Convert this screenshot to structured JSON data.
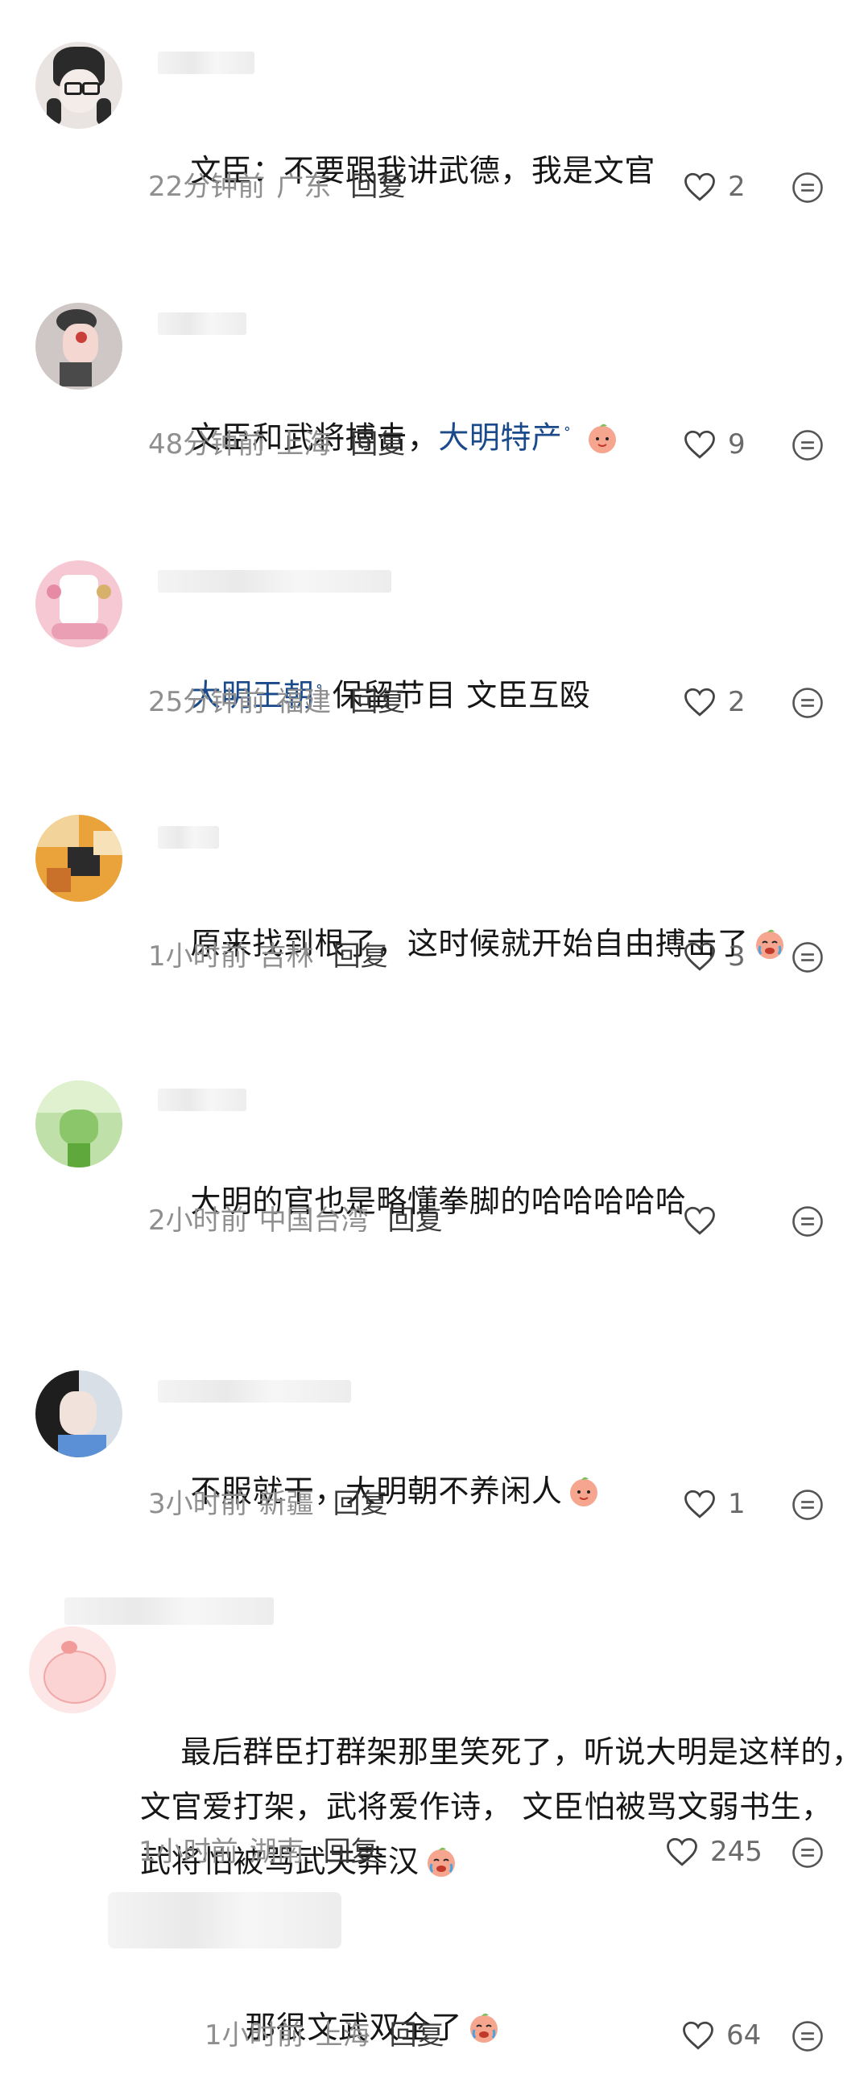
{
  "comments": [
    {
      "text_a": "文臣：不要跟我讲武德，我是文官",
      "time": "22分钟前",
      "loc": "广东",
      "reply": "回复",
      "likes": "2"
    },
    {
      "text_a": "文臣和武将搏击，",
      "link": "大明特产",
      "time": "48分钟前",
      "loc": "上海",
      "reply": "回复",
      "likes": "9",
      "emoji": "peach-face-emoji"
    },
    {
      "link": "大明王朝",
      "text_b": "保留节目 文臣互殴",
      "time": "25分钟前",
      "loc": "福建",
      "reply": "回复",
      "likes": "2"
    },
    {
      "text_a": "原来找到根了，这时候就开始自由搏击了",
      "time": "1小时前",
      "loc": "吉林",
      "reply": "回复",
      "likes": "3",
      "emoji": "crying-laughing-peach-emoji"
    },
    {
      "text_a": "大明的官也是略懂拳脚的哈哈哈哈哈",
      "time": "2小时前",
      "loc": "中国台湾",
      "reply": "回复",
      "likes": ""
    },
    {
      "text_a": "不服就干，大明朝不养闲人",
      "time": "3小时前",
      "loc": "新疆",
      "reply": "回复",
      "likes": "1",
      "emoji": "peach-face-emoji"
    },
    {
      "text_a": "最后群臣打群架那里笑死了，听说大明是这样的，",
      "text_b": "文官爱打架，武将爱作诗， 文臣怕被骂文弱书生，",
      "text_c": "武将怕被骂武夫莽汉",
      "time": "1小时前",
      "loc": "湖南",
      "reply": "回复",
      "likes": "245",
      "emoji": "crying-laughing-peach-emoji"
    },
    {
      "text_a": "那很文武双全了",
      "time": "1小时前",
      "loc": "上海",
      "reply": "回复",
      "likes": "64",
      "emoji": "crying-laughing-peach-emoji"
    }
  ],
  "icons": {
    "like": "heart-outline-icon",
    "more": "ellipsis-circle-icon",
    "link_search": "search-small-icon"
  },
  "colors": {
    "link": "#1a4a8a",
    "meta": "#8f8f8f",
    "emoji_peach": "#f6a58f"
  }
}
